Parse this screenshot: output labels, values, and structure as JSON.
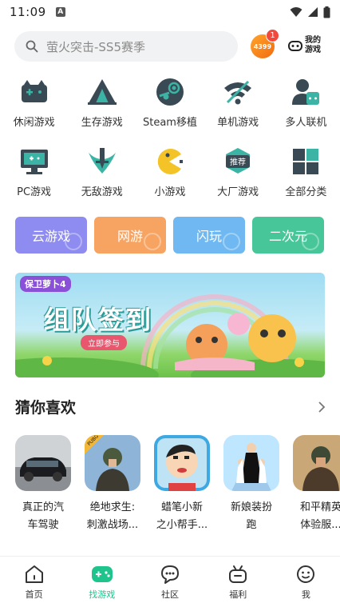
{
  "status_bar": {
    "time": "11:09",
    "notification": "A"
  },
  "search": {
    "placeholder": "萤火突击-SS5赛季"
  },
  "header": {
    "avatar_text": "4399",
    "badge_count": "1",
    "my_games_line1": "我的",
    "my_games_line2": "游戏"
  },
  "categories": [
    {
      "label": "休闲游戏",
      "icon": "gamepad-icon"
    },
    {
      "label": "生存游戏",
      "icon": "tent-icon"
    },
    {
      "label": "Steam移植",
      "icon": "steam-icon"
    },
    {
      "label": "单机游戏",
      "icon": "offline-wifi-icon"
    },
    {
      "label": "多人联机",
      "icon": "multiplayer-icon"
    },
    {
      "label": "PC游戏",
      "icon": "monitor-icon"
    },
    {
      "label": "无敌游戏",
      "icon": "sword-icon"
    },
    {
      "label": "小游戏",
      "icon": "pacman-icon"
    },
    {
      "label": "大厂游戏",
      "icon": "recommend-icon"
    },
    {
      "label": "全部分类",
      "icon": "grid-icon"
    }
  ],
  "recommend_badge": "推荐",
  "chips": [
    {
      "label": "云游戏",
      "color": "#8e8cf0"
    },
    {
      "label": "网游",
      "color": "#f7a462"
    },
    {
      "label": "闪玩",
      "color": "#6fb8f1"
    },
    {
      "label": "二次元",
      "color": "#47c799"
    }
  ],
  "banner": {
    "tag": "保卫萝卜4",
    "title": "组队签到",
    "button": "立即参与"
  },
  "section": {
    "title": "猜你喜欢"
  },
  "games": [
    {
      "name": "真正的汽\n车驾驶"
    },
    {
      "name": "绝地求生:\n刺激战场..."
    },
    {
      "name": "蜡笔小新\n之小帮手..."
    },
    {
      "name": "新娘装扮\n跑"
    },
    {
      "name": "和平精英\n体验服..."
    }
  ],
  "game_badge": "PUBG",
  "nav": [
    {
      "label": "首页",
      "icon": "home-icon"
    },
    {
      "label": "找游戏",
      "icon": "find-game-icon"
    },
    {
      "label": "社区",
      "icon": "chat-icon"
    },
    {
      "label": "福利",
      "icon": "gift-icon"
    },
    {
      "label": "我",
      "icon": "smile-icon"
    }
  ],
  "colors": {
    "accent": "#1ec48c",
    "icon_dark": "#3a4a55",
    "icon_teal": "#3bb3a5"
  }
}
